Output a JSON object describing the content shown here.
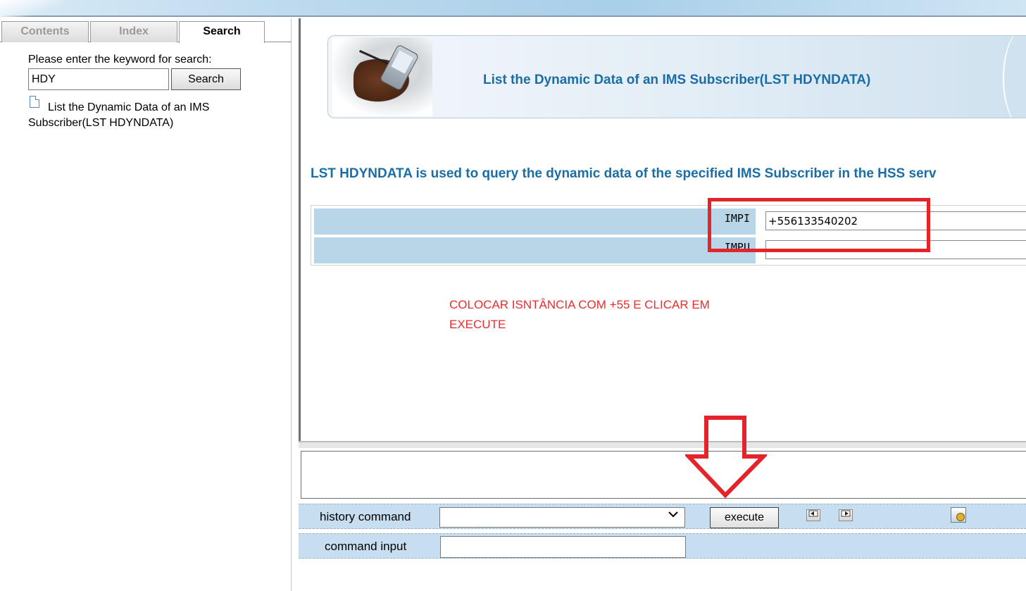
{
  "help_pane": {
    "tabs": [
      "Contents",
      "Index",
      "Search"
    ],
    "active_tab": "Search",
    "search_label": "Please enter the keyword for search:",
    "keyword_value": "HDY",
    "search_button": "Search",
    "result_link": "List the Dynamic Data of an IMS Subscriber(LST HDYNDATA)"
  },
  "main": {
    "banner_title": "List the Dynamic Data of an IMS Subscriber(LST HDYNDATA)",
    "description": "LST HDYNDATA is used to query the dynamic data of the specified IMS Subscriber in the HSS serv",
    "params": [
      {
        "label": "IMPI",
        "value": "+556133540202"
      },
      {
        "label": "IMPU",
        "value": ""
      }
    ],
    "annotation_line1": "COLOCAR ISNTÂNCIA COM +55 E CLICAR EM",
    "annotation_line2": "EXECUTE"
  },
  "command_bar": {
    "history_label": "history command",
    "history_value": "",
    "execute_label": "execute",
    "command_input_label": "command input",
    "command_input_value": ""
  },
  "colors": {
    "title_blue": "#1a6ea5",
    "param_bg": "#b8d6e8",
    "annotation_red": "#e4242a"
  },
  "icons": {
    "history_chevron": "chevron-down-icon",
    "prev": "arrow-left-icon",
    "next": "arrow-right-icon",
    "tool": "settings-tool-icon"
  }
}
